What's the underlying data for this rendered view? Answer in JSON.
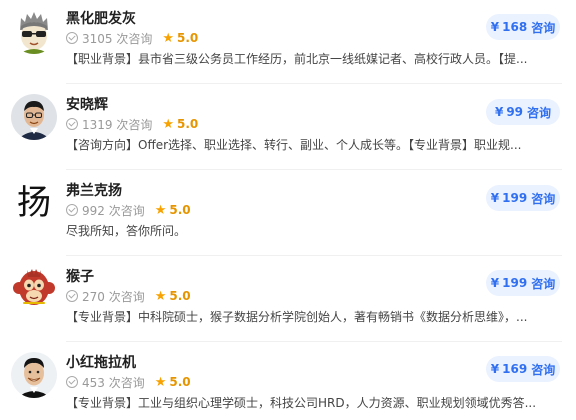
{
  "experts": [
    {
      "name": "黑化肥发灰",
      "count_text": "3105 次咨询",
      "rating": "5.0",
      "description": "【职业背景】县市省三级公务员工作经历，前北京一线纸媒记者、高校行政人员。【提...",
      "price": "168",
      "price_currency": "¥",
      "consult_label": "咨询",
      "avatar_icon": "cartoon-boy-sunglasses-icon"
    },
    {
      "name": "安晓辉",
      "count_text": "1319 次咨询",
      "rating": "5.0",
      "description": "【咨询方向】Offer选择、职业选择、转行、副业、个人成长等。【专业背景】职业规...",
      "price": "99",
      "price_currency": "¥",
      "consult_label": "咨询",
      "avatar_icon": "man-glasses-photo-icon"
    },
    {
      "name": "弗兰克扬",
      "count_text": "992 次咨询",
      "rating": "5.0",
      "description": "尽我所知，答你所问。",
      "price": "199",
      "price_currency": "¥",
      "consult_label": "咨询",
      "avatar_icon": "calligraphy-character-icon",
      "avatar_char": "扬"
    },
    {
      "name": "猴子",
      "count_text": "270 次咨询",
      "rating": "5.0",
      "description": "【专业背景】中科院硕士，猴子数据分析学院创始人，著有畅销书《数据分析思维》，...",
      "price": "199",
      "price_currency": "¥",
      "consult_label": "咨询",
      "avatar_icon": "monkey-mascot-icon"
    },
    {
      "name": "小红拖拉机",
      "count_text": "453 次咨询",
      "rating": "5.0",
      "description": "【专业背景】工业与组织心理学硕士，科技公司HRD，人力资源、职业规划领域优秀答...",
      "price": "169",
      "price_currency": "¥",
      "consult_label": "咨询",
      "avatar_icon": "smiling-man-photo-icon"
    }
  ],
  "colors": {
    "accent": "#3070f0",
    "button_bg": "#eaf1ff",
    "star": "#f7a200"
  }
}
